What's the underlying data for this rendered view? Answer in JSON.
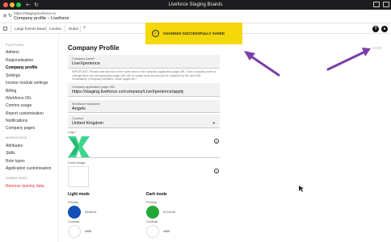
{
  "window": {
    "title": "Liveforce Staging Boards"
  },
  "header": {
    "url": "https://staging.liveforce.co",
    "page_title": "Company profile – Liveforce"
  },
  "app_tabs": [
    "Large Events Board",
    "London",
    "Dubai"
  ],
  "tab_add": "+",
  "header_buttons": [
    "?",
    "●"
  ],
  "sidebar": {
    "sections": [
      {
        "heading": "PLATFORM",
        "items": [
          "Admins",
          "Regionalisation",
          "Company profile",
          "Settings",
          "Invoice module settings",
          "Billing",
          "Workforce IDs",
          "Comms usage",
          "Report customisation",
          "Notifications",
          "Company pages"
        ]
      },
      {
        "heading": "WORKFORCE",
        "items": [
          "Attributes",
          "Skills",
          "Role types",
          "Application customisation"
        ]
      },
      {
        "heading": "DUMMY DATA",
        "items": [
          "Remove dummy data"
        ]
      }
    ],
    "active_item": "Company profile"
  },
  "toast": {
    "text": "CHANGES SUCCESSFULLY SAVED",
    "icon": "check-circle-icon",
    "color": "#f4d80a"
  },
  "main": {
    "title": "Company Profile",
    "save_label": "SAVE",
    "company_name": {
      "label": "Company name*",
      "value": "LiveXperience",
      "help": "IMPORTANT: Please note that this is the name used in the company application page URL. If the company name is changed then the old application page URL will no longer work and should be replaced by the new URL immediately. (Company websites, social pages etc.)"
    },
    "application_url": {
      "label": "Company application page URL",
      "value": "https://staging.liveforce.co/company/LiveXperience/apply"
    },
    "workforce_nickname": {
      "label": "Workforce nickname",
      "value": "Angels"
    },
    "country": {
      "label": "Country*",
      "value": "United Kingdom"
    },
    "logo_label": "Logo *",
    "cover_label": "Cover image",
    "light_mode": {
      "title": "Light mode",
      "primary_label": "Primary",
      "primary_hex": "#0c50c4",
      "primary_color": "#1250b8",
      "contrast_label": "Contrast",
      "contrast_hex": "#ffffff"
    },
    "dark_mode": {
      "title": "Dark mode",
      "primary_label": "Primary",
      "primary_hex": "#21b138",
      "primary_color": "#22a836",
      "contrast_label": "Contrast",
      "contrast_hex": "#ffffff"
    }
  }
}
